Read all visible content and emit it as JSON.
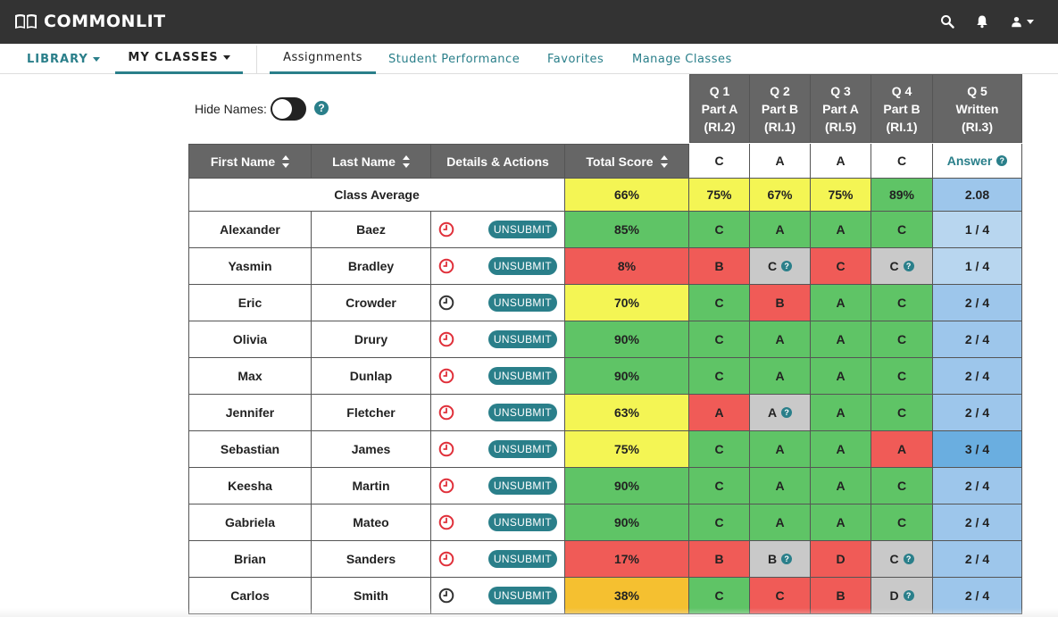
{
  "app": {
    "brand": "COMMONLIT"
  },
  "nav": {
    "library": "LIBRARY",
    "my_classes": "MY CLASSES",
    "tabs": [
      "Assignments",
      "Student Performance",
      "Favorites",
      "Manage Classes"
    ]
  },
  "hide_names": {
    "label": "Hide Names:",
    "enabled": false
  },
  "table": {
    "columns": {
      "first_name": "First Name",
      "last_name": "Last Name",
      "details": "Details & Actions",
      "total": "Total Score"
    },
    "questions": [
      {
        "line1": "Q 1",
        "line2": "Part A",
        "line3": "(RI.2)",
        "key": "C"
      },
      {
        "line1": "Q 2",
        "line2": "Part B",
        "line3": "(RI.1)",
        "key": "A"
      },
      {
        "line1": "Q 3",
        "line2": "Part A",
        "line3": "(RI.5)",
        "key": "A"
      },
      {
        "line1": "Q 4",
        "line2": "Part B",
        "line3": "(RI.1)",
        "key": "C"
      },
      {
        "line1": "Q 5",
        "line2": "Written",
        "line3": "(RI.3)",
        "key": "Answer"
      }
    ],
    "class_average": {
      "label": "Class Average",
      "total": "66%",
      "q": [
        "75%",
        "67%",
        "75%",
        "89%",
        "2.08"
      ]
    },
    "unsubmit_label": "UNSUBMIT",
    "colors": {
      "green": "#5fc466",
      "yellow": "#f4f554",
      "red": "#f05b57",
      "orange": "#f5c030",
      "gray": "#c9c9c9",
      "blue_light": "#b8d6ef",
      "blue_mid": "#9dc6eb",
      "blue_dark": "#6aaee0",
      "teal": "#2a7f8a"
    },
    "rows": [
      {
        "first": "Alexander",
        "last": "Baez",
        "clock": "red",
        "total": "85%",
        "total_color": "green",
        "answers": [
          [
            "C",
            "green",
            false
          ],
          [
            "A",
            "green",
            false
          ],
          [
            "A",
            "green",
            false
          ],
          [
            "C",
            "green",
            false
          ]
        ],
        "written": "1 / 4",
        "written_color": "blue_light"
      },
      {
        "first": "Yasmin",
        "last": "Bradley",
        "clock": "red",
        "total": "8%",
        "total_color": "red",
        "answers": [
          [
            "B",
            "red",
            false
          ],
          [
            "C",
            "gray",
            true
          ],
          [
            "C",
            "red",
            false
          ],
          [
            "C",
            "gray",
            true
          ]
        ],
        "written": "1 / 4",
        "written_color": "blue_light"
      },
      {
        "first": "Eric",
        "last": "Crowder",
        "clock": "dark",
        "total": "70%",
        "total_color": "yellow",
        "answers": [
          [
            "C",
            "green",
            false
          ],
          [
            "B",
            "red",
            false
          ],
          [
            "A",
            "green",
            false
          ],
          [
            "C",
            "green",
            false
          ]
        ],
        "written": "2 / 4",
        "written_color": "blue_mid"
      },
      {
        "first": "Olivia",
        "last": "Drury",
        "clock": "red",
        "total": "90%",
        "total_color": "green",
        "answers": [
          [
            "C",
            "green",
            false
          ],
          [
            "A",
            "green",
            false
          ],
          [
            "A",
            "green",
            false
          ],
          [
            "C",
            "green",
            false
          ]
        ],
        "written": "2 / 4",
        "written_color": "blue_mid"
      },
      {
        "first": "Max",
        "last": "Dunlap",
        "clock": "red",
        "total": "90%",
        "total_color": "green",
        "answers": [
          [
            "C",
            "green",
            false
          ],
          [
            "A",
            "green",
            false
          ],
          [
            "A",
            "green",
            false
          ],
          [
            "C",
            "green",
            false
          ]
        ],
        "written": "2 / 4",
        "written_color": "blue_mid"
      },
      {
        "first": "Jennifer",
        "last": "Fletcher",
        "clock": "red",
        "total": "63%",
        "total_color": "yellow",
        "answers": [
          [
            "A",
            "red",
            false
          ],
          [
            "A",
            "gray",
            true
          ],
          [
            "A",
            "green",
            false
          ],
          [
            "C",
            "green",
            false
          ]
        ],
        "written": "2 / 4",
        "written_color": "blue_mid"
      },
      {
        "first": "Sebastian",
        "last": "James",
        "clock": "red",
        "total": "75%",
        "total_color": "yellow",
        "answers": [
          [
            "C",
            "green",
            false
          ],
          [
            "A",
            "green",
            false
          ],
          [
            "A",
            "green",
            false
          ],
          [
            "A",
            "red",
            false
          ]
        ],
        "written": "3 / 4",
        "written_color": "blue_dark"
      },
      {
        "first": "Keesha",
        "last": "Martin",
        "clock": "red",
        "total": "90%",
        "total_color": "green",
        "answers": [
          [
            "C",
            "green",
            false
          ],
          [
            "A",
            "green",
            false
          ],
          [
            "A",
            "green",
            false
          ],
          [
            "C",
            "green",
            false
          ]
        ],
        "written": "2 / 4",
        "written_color": "blue_mid"
      },
      {
        "first": "Gabriela",
        "last": "Mateo",
        "clock": "red",
        "total": "90%",
        "total_color": "green",
        "answers": [
          [
            "C",
            "green",
            false
          ],
          [
            "A",
            "green",
            false
          ],
          [
            "A",
            "green",
            false
          ],
          [
            "C",
            "green",
            false
          ]
        ],
        "written": "2 / 4",
        "written_color": "blue_mid"
      },
      {
        "first": "Brian",
        "last": "Sanders",
        "clock": "red",
        "total": "17%",
        "total_color": "red",
        "answers": [
          [
            "B",
            "red",
            false
          ],
          [
            "B",
            "gray",
            true
          ],
          [
            "D",
            "red",
            false
          ],
          [
            "C",
            "gray",
            true
          ]
        ],
        "written": "2 / 4",
        "written_color": "blue_mid"
      },
      {
        "first": "Carlos",
        "last": "Smith",
        "clock": "dark",
        "total": "38%",
        "total_color": "orange",
        "answers": [
          [
            "C",
            "green",
            false
          ],
          [
            "C",
            "red",
            false
          ],
          [
            "B",
            "red",
            false
          ],
          [
            "D",
            "gray",
            true
          ]
        ],
        "written": "2 / 4",
        "written_color": "blue_mid"
      }
    ]
  }
}
